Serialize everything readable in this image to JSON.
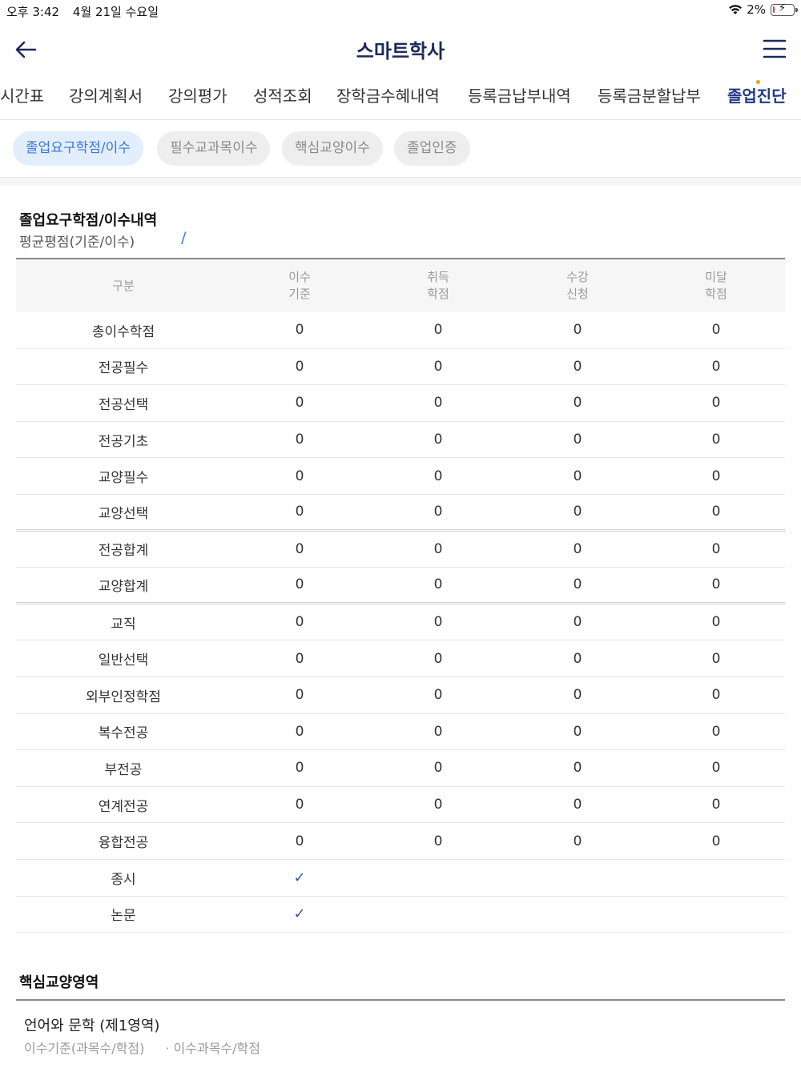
{
  "status_bar": {
    "time": "오후 3:42",
    "date": "4월 21일 수요일",
    "battery": "2%",
    "battery_level": 0.02
  },
  "header": {
    "title": "스마트학사"
  },
  "nav_tabs": [
    {
      "label": "시간표",
      "active": false
    },
    {
      "label": "강의계획서",
      "active": false
    },
    {
      "label": "강의평가",
      "active": false
    },
    {
      "label": "성적조회",
      "active": false
    },
    {
      "label": "장학금수혜내역",
      "active": false
    },
    {
      "label": "등록금납부내역",
      "active": false
    },
    {
      "label": "등록금분할납부",
      "active": false
    },
    {
      "label": "졸업진단",
      "active": true
    }
  ],
  "sub_tabs": [
    {
      "label": "졸업요구학점/이수",
      "active": true
    },
    {
      "label": "필수교과목이수",
      "active": false
    },
    {
      "label": "핵심교양이수",
      "active": false
    },
    {
      "label": "졸업인증",
      "active": false
    }
  ],
  "requirements": {
    "title": "졸업요구학점/이수내역",
    "avg_label": "평균평점(기준/이수)",
    "avg_value": "/",
    "columns": {
      "category": "구분",
      "standard": [
        "이수",
        "기준"
      ],
      "earned": [
        "취득",
        "학점"
      ],
      "enrolled": [
        "수강",
        "신청"
      ],
      "shortfall": [
        "미달",
        "학점"
      ]
    },
    "rows": [
      {
        "label": "총이수학점",
        "standard": "0",
        "earned": "0",
        "enrolled": "0",
        "shortfall": "0"
      },
      {
        "label": "전공필수",
        "standard": "0",
        "earned": "0",
        "enrolled": "0",
        "shortfall": "0"
      },
      {
        "label": "전공선택",
        "standard": "0",
        "earned": "0",
        "enrolled": "0",
        "shortfall": "0"
      },
      {
        "label": "전공기초",
        "standard": "0",
        "earned": "0",
        "enrolled": "0",
        "shortfall": "0"
      },
      {
        "label": "교양필수",
        "standard": "0",
        "earned": "0",
        "enrolled": "0",
        "shortfall": "0"
      },
      {
        "label": "교양선택",
        "standard": "0",
        "earned": "0",
        "enrolled": "0",
        "shortfall": "0"
      },
      {
        "label": "전공합계",
        "standard": "0",
        "earned": "0",
        "enrolled": "0",
        "shortfall": "0"
      },
      {
        "label": "교양합계",
        "standard": "0",
        "earned": "0",
        "enrolled": "0",
        "shortfall": "0"
      },
      {
        "label": "교직",
        "standard": "0",
        "earned": "0",
        "enrolled": "0",
        "shortfall": "0"
      },
      {
        "label": "일반선택",
        "standard": "0",
        "earned": "0",
        "enrolled": "0",
        "shortfall": "0"
      },
      {
        "label": "외부인정학점",
        "standard": "0",
        "earned": "0",
        "enrolled": "0",
        "shortfall": "0"
      },
      {
        "label": "복수전공",
        "standard": "0",
        "earned": "0",
        "enrolled": "0",
        "shortfall": "0"
      },
      {
        "label": "부전공",
        "standard": "0",
        "earned": "0",
        "enrolled": "0",
        "shortfall": "0"
      },
      {
        "label": "연계전공",
        "standard": "0",
        "earned": "0",
        "enrolled": "0",
        "shortfall": "0"
      },
      {
        "label": "융합전공",
        "standard": "0",
        "earned": "0",
        "enrolled": "0",
        "shortfall": "0"
      },
      {
        "label": "종시",
        "check": "✓"
      },
      {
        "label": "논문",
        "check": "✓"
      }
    ]
  },
  "core_liberal": {
    "title": "핵심교양영역",
    "area_title": "언어와 문학 (제1영역)",
    "standard_label": "이수기준(과목수/학점)",
    "completed_label": "· 이수과목수/학점"
  },
  "colors": {
    "brand": "#1a2a5a",
    "active_tab": "#1f3a8a",
    "chip_active_bg": "#e3eefc",
    "chip_active_text": "#3a78d8",
    "check": "#3556a6",
    "battery_low": "#e53935",
    "notification_dot": "#f39c2b"
  }
}
